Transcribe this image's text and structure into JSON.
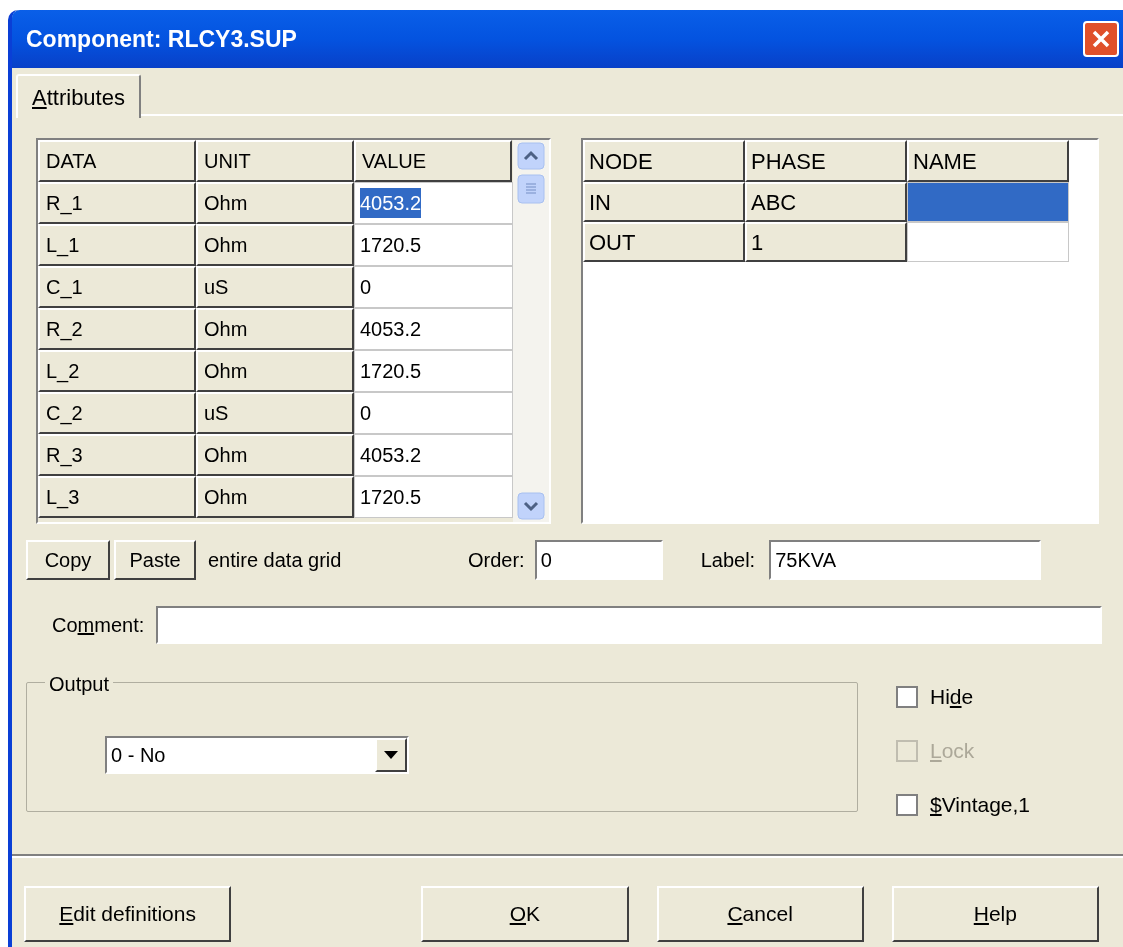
{
  "window": {
    "title": "Component: RLCY3.SUP"
  },
  "tabs": [
    {
      "key": "A",
      "post": "ttributes",
      "selected": true
    }
  ],
  "data_grid": {
    "columns": [
      "DATA",
      "UNIT",
      "VALUE"
    ],
    "rows": [
      {
        "data": "R_1",
        "unit": "Ohm",
        "value": "4053.2",
        "selected": true
      },
      {
        "data": "L_1",
        "unit": "Ohm",
        "value": "1720.5",
        "selected": false
      },
      {
        "data": "C_1",
        "unit": "uS",
        "value": "0",
        "selected": false
      },
      {
        "data": "R_2",
        "unit": "Ohm",
        "value": "4053.2",
        "selected": false
      },
      {
        "data": "L_2",
        "unit": "Ohm",
        "value": "1720.5",
        "selected": false
      },
      {
        "data": "C_2",
        "unit": "uS",
        "value": "0",
        "selected": false
      },
      {
        "data": "R_3",
        "unit": "Ohm",
        "value": "4053.2",
        "selected": false
      },
      {
        "data": "L_3",
        "unit": "Ohm",
        "value": "1720.5",
        "selected": false
      }
    ]
  },
  "node_grid": {
    "columns": [
      "NODE",
      "PHASE",
      "NAME"
    ],
    "rows": [
      {
        "node": "IN",
        "phase": "ABC",
        "selected": true
      },
      {
        "node": "OUT",
        "phase": "1",
        "selected": false
      }
    ]
  },
  "copy_button": "Copy",
  "paste_button": "Paste",
  "grid_note": "entire data grid",
  "order": {
    "label": "Order:",
    "value": "0"
  },
  "label_field": {
    "label": "Label:",
    "value": "75KVA"
  },
  "comment": {
    "pre": "Co",
    "key": "m",
    "post": "ment:"
  },
  "output": {
    "title": "Output",
    "value": "0 - No"
  },
  "checkboxes": [
    {
      "pre": "Hi",
      "key": "d",
      "post": "e",
      "checked": false,
      "disabled": false
    },
    {
      "key": "L",
      "post": "ock",
      "checked": false,
      "disabled": true
    },
    {
      "key": "$",
      "post": "Vintage,1",
      "checked": false,
      "disabled": false
    }
  ],
  "buttons": [
    {
      "key": "E",
      "post": "dit definitions"
    },
    {
      "key": "O",
      "post": "K"
    },
    {
      "key": "C",
      "post": "ancel"
    },
    {
      "key": "H",
      "post": "elp"
    }
  ]
}
